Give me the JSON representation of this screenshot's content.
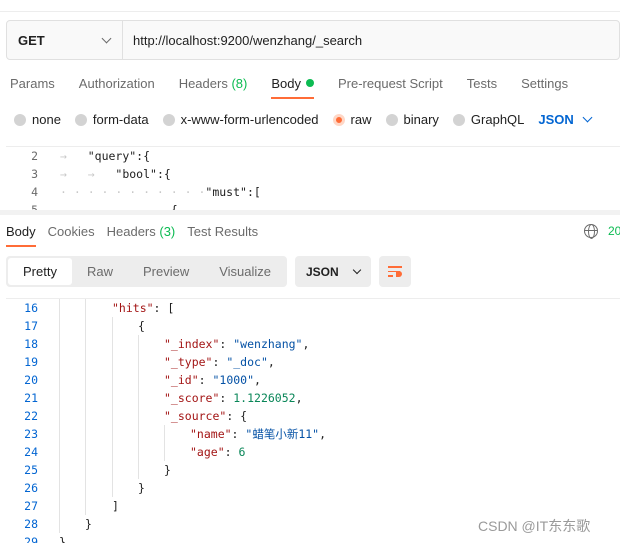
{
  "request": {
    "method": "GET",
    "url": "http://localhost:9200/wenzhang/_search"
  },
  "request_tabs": [
    {
      "label": "Params"
    },
    {
      "label": "Authorization"
    },
    {
      "label": "Headers",
      "count": "(8)"
    },
    {
      "label": "Body"
    },
    {
      "label": "Pre-request Script"
    },
    {
      "label": "Tests"
    },
    {
      "label": "Settings"
    }
  ],
  "body_types": [
    "none",
    "form-data",
    "x-www-form-urlencoded",
    "raw",
    "binary",
    "GraphQL"
  ],
  "body_format": "JSON",
  "editor_lines": [
    {
      "n": "2",
      "text": "\"query\":{"
    },
    {
      "n": "3",
      "text": "\"bool\":{"
    },
    {
      "n": "4",
      "text": "\"must\":["
    },
    {
      "n": "5",
      "text": "{"
    }
  ],
  "response_tabs": [
    {
      "label": "Body"
    },
    {
      "label": "Cookies"
    },
    {
      "label": "Headers",
      "count": "(3)"
    },
    {
      "label": "Test Results"
    }
  ],
  "status_partial": "20",
  "view_modes": [
    "Pretty",
    "Raw",
    "Preview",
    "Visualize"
  ],
  "response_format": "JSON",
  "response_lines": [
    {
      "n": "16",
      "key": "\"hits\"",
      "rest": ": ["
    },
    {
      "n": "17",
      "text": "{"
    },
    {
      "n": "18",
      "key": "\"_index\"",
      "sval": "\"wenzhang\""
    },
    {
      "n": "19",
      "key": "\"_type\"",
      "sval": "\"_doc\""
    },
    {
      "n": "20",
      "key": "\"_id\"",
      "sval": "\"1000\""
    },
    {
      "n": "21",
      "key": "\"_score\"",
      "nval": "1.1226052"
    },
    {
      "n": "22",
      "key": "\"_source\"",
      "rest": ": {"
    },
    {
      "n": "23",
      "key": "\"name\"",
      "sval": "\"蜡笔小新11\""
    },
    {
      "n": "24",
      "key": "\"age\"",
      "nval": "6"
    },
    {
      "n": "25",
      "text": "}"
    },
    {
      "n": "26",
      "text": "}"
    },
    {
      "n": "27",
      "text": "]"
    },
    {
      "n": "28",
      "text": "}"
    },
    {
      "n": "29",
      "text": "}"
    }
  ],
  "watermark": "CSDN @IT东东歌"
}
